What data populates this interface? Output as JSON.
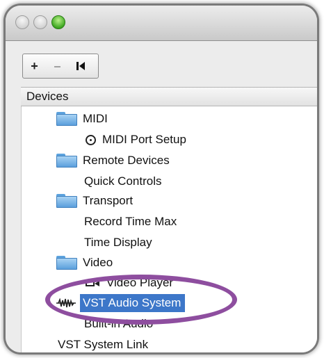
{
  "toolbar": {
    "add_label": "+",
    "remove_label": "–"
  },
  "header": {
    "title": "Devices"
  },
  "tree": {
    "midi": "MIDI",
    "midi_port_setup": "MIDI Port Setup",
    "remote_devices": "Remote Devices",
    "quick_controls": "Quick Controls",
    "transport": "Transport",
    "record_time_max": "Record Time Max",
    "time_display": "Time Display",
    "video": "Video",
    "video_player": "Video Player",
    "vst_audio_system": "VST Audio System",
    "built_in_audio": "Built-in Audio",
    "vst_system_link": "VST System Link"
  },
  "colors": {
    "selection": "#3d77c9",
    "annotation_ring": "#8e4e9f",
    "folder": "#5b9fdc"
  },
  "icons": {
    "folder": "folder-icon",
    "port": "midi-port-icon",
    "video": "video-camera-icon",
    "audio": "audio-wave-icon"
  }
}
